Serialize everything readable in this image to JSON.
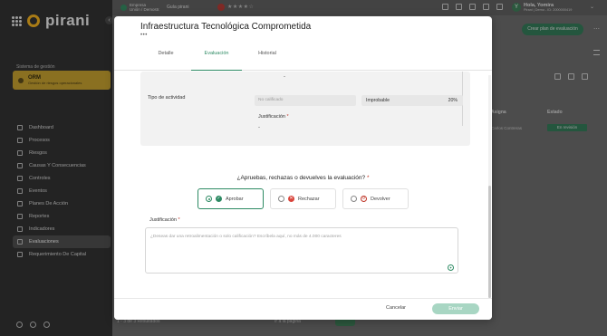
{
  "app": {
    "logo": "pirani",
    "system_label": "Sistema de gestión",
    "module": {
      "name": "ORM",
      "subtitle": "Gestión de riesgos operacionales"
    },
    "nav": [
      {
        "label": "Dashboard",
        "icon": "monitor-icon"
      },
      {
        "label": "Procesos",
        "icon": "process-icon"
      },
      {
        "label": "Riesgos",
        "icon": "risk-icon"
      },
      {
        "label": "Causas Y Consecuencias",
        "icon": "cause-icon"
      },
      {
        "label": "Controles",
        "icon": "controls-icon"
      },
      {
        "label": "Eventos",
        "icon": "events-icon"
      },
      {
        "label": "Planes De Acción",
        "icon": "action-plan-icon"
      },
      {
        "label": "Reportes",
        "icon": "reports-icon"
      },
      {
        "label": "Indicadores",
        "icon": "indicators-icon"
      },
      {
        "label": "Evaluaciones",
        "icon": "evaluations-icon",
        "active": true
      },
      {
        "label": "Requerimiento De Capital",
        "icon": "capital-icon"
      }
    ]
  },
  "topbar": {
    "company_name": "Empresa",
    "company_sub": "Unión / Demostr.",
    "guide": "Guía pirani",
    "user_greeting": "Hola, Yomira",
    "user_sub": "Pirani | Demo - ID: 2000000419",
    "avatar_letter": "Y"
  },
  "background_page": {
    "create_plan_button": "Crear plan de evaluación",
    "col_responsible": "Asigna",
    "col_state": "Estado",
    "row_responsible": "Carlos Contreras",
    "row_state": "En revisión",
    "pager_text": "1 - 3 de 3 Resultados",
    "pager_go": "Ir a la página"
  },
  "modal": {
    "title": "Infraestructura Tecnológica Comprometida",
    "dots": "•••",
    "tabs": [
      "Detalle",
      "Evaluación",
      "Historial"
    ],
    "active_tab": "Evaluación",
    "card": {
      "top_dash": "-",
      "activity_label": "Tipo de actividad",
      "not_qualified": "No calificado",
      "probability_label": "Improbable",
      "probability_value": "20%",
      "justification_label": "Justificación",
      "justification_value": "-"
    },
    "question": "¿Apruebas, rechazas o devuelves la evaluación?",
    "required_mark": "*",
    "options": [
      {
        "label": "Aprobar",
        "selected": true
      },
      {
        "label": "Rechazar",
        "selected": false
      },
      {
        "label": "Devolver",
        "selected": false
      }
    ],
    "justification_label": "Justificación",
    "justification_placeholder": "¿Deseas dar una retroalimentación o solo calificación? Escríbela aquí, no más de 4.000 caracteres",
    "cancel_label": "Cancelar",
    "send_label": "Enviar"
  },
  "colors": {
    "brand_green": "#2d8a63",
    "send_disabled": "#a8d6c3",
    "reject_red": "#d9443b",
    "module_gold": "#c9a129"
  }
}
